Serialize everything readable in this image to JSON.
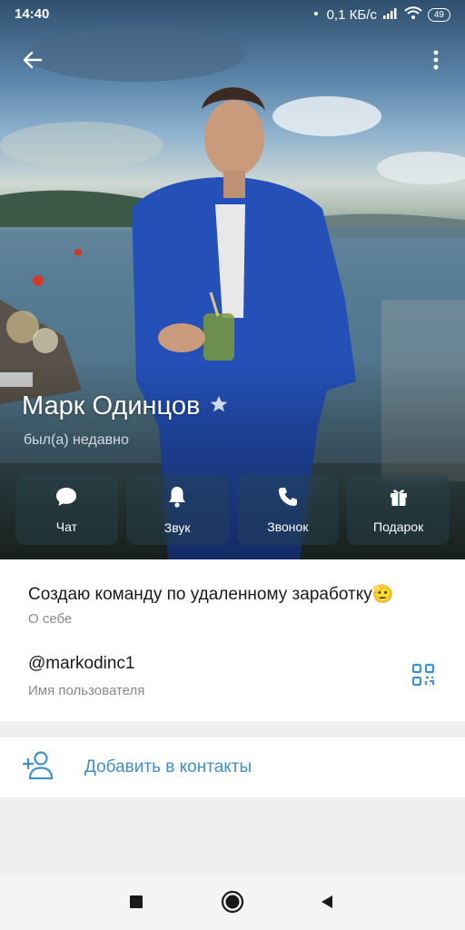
{
  "status_bar": {
    "time": "14:40",
    "network_speed": "0,1 КБ/с",
    "battery": "49"
  },
  "header": {
    "back_icon": "arrow-left-icon",
    "menu_icon": "more-vertical-icon"
  },
  "profile": {
    "name": "Марк Одинцов",
    "badge_icon": "star-icon",
    "last_seen": "был(а) недавно"
  },
  "actions": [
    {
      "id": "chat",
      "label": "Чат",
      "icon": "chat-bubble-icon"
    },
    {
      "id": "sound",
      "label": "Звук",
      "icon": "bell-icon"
    },
    {
      "id": "call",
      "label": "Звонок",
      "icon": "phone-icon"
    },
    {
      "id": "gift",
      "label": "Подарок",
      "icon": "gift-icon"
    }
  ],
  "info": {
    "bio": "Создаю команду по удаленному заработку",
    "bio_emoji": "🫡",
    "bio_caption": "О себе",
    "username": "@markodinc1",
    "username_caption": "Имя пользователя",
    "qr_icon": "qr-code-icon"
  },
  "add_contact": {
    "label": "Добавить в контакты",
    "icon": "add-user-icon"
  },
  "colors": {
    "accent": "#3d8fce",
    "caption": "#8a8a8e",
    "background": "#efeff1"
  },
  "nav_bar": {
    "icons": [
      "square-icon",
      "circle-home-icon",
      "triangle-back-icon"
    ]
  }
}
